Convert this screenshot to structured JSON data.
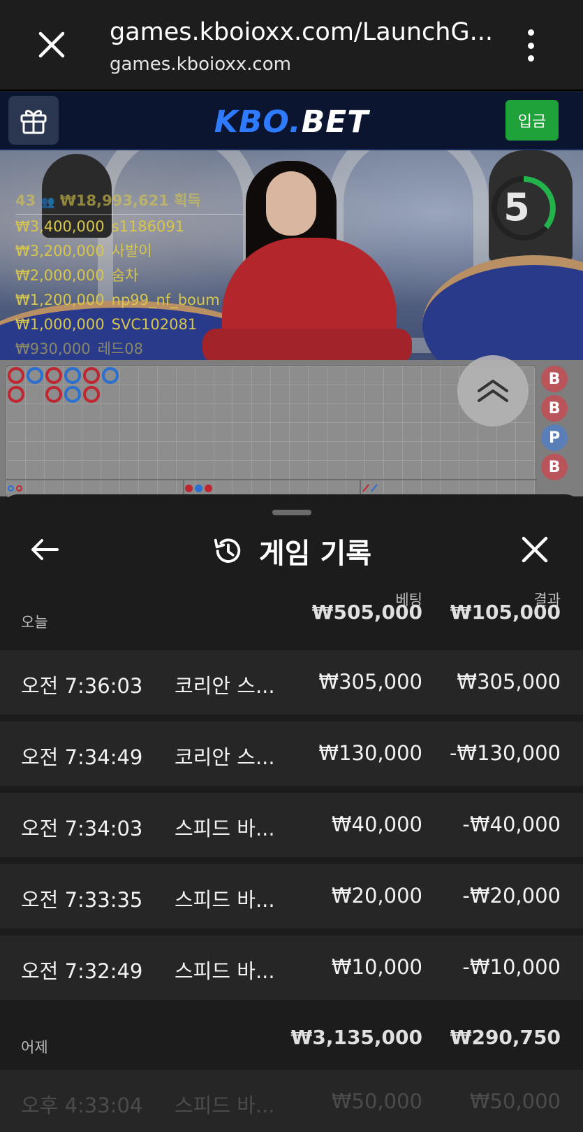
{
  "browser": {
    "url": "games.kboioxx.com/LaunchG...",
    "domain": "games.kboioxx.com"
  },
  "site": {
    "logo_part1": "KBO.",
    "logo_part2": "BET",
    "deposit_label": "입금"
  },
  "video": {
    "total_winners": "43",
    "total_amount": "₩18,993,621",
    "total_suffix": "획득",
    "winners": [
      {
        "amount": "₩3,400,000",
        "name": "s1186091"
      },
      {
        "amount": "₩3,200,000",
        "name": "사발이"
      },
      {
        "amount": "₩2,000,000",
        "name": "숨차"
      },
      {
        "amount": "₩1,200,000",
        "name": "np99_nf_boum"
      },
      {
        "amount": "₩1,000,000",
        "name": "SVC102081"
      },
      {
        "amount": "₩930,000",
        "name": "레드08"
      }
    ],
    "countdown": "5"
  },
  "roadmap": {
    "side_beads": [
      "B",
      "B",
      "P",
      "B"
    ]
  },
  "sheet": {
    "title": "게임 기록",
    "col_bet": "베팅",
    "col_result": "결과",
    "today": {
      "label": "오늘",
      "bet_total": "₩505,000",
      "result_total": "₩105,000"
    },
    "rows": [
      {
        "time": "오전 7:36:03",
        "game": "코리안 스...",
        "bet": "₩305,000",
        "result": "₩305,000"
      },
      {
        "time": "오전 7:34:49",
        "game": "코리안 스...",
        "bet": "₩130,000",
        "result": "-₩130,000"
      },
      {
        "time": "오전 7:34:03",
        "game": "스피드 바...",
        "bet": "₩40,000",
        "result": "-₩40,000"
      },
      {
        "time": "오전 7:33:35",
        "game": "스피드 바...",
        "bet": "₩20,000",
        "result": "-₩20,000"
      },
      {
        "time": "오전 7:32:49",
        "game": "스피드 바...",
        "bet": "₩10,000",
        "result": "-₩10,000"
      }
    ],
    "yesterday": {
      "label": "어제",
      "bet_total": "₩3,135,000",
      "result_total": "₩290,750"
    },
    "faded_row": {
      "time": "오후 4:33:04",
      "game": "스피드 바...",
      "bet": "₩50,000",
      "result": "₩50,000"
    }
  },
  "colors": {
    "banker_red": "#c0262f",
    "player_blue": "#2a6fd2",
    "deposit_green": "#1fa23a",
    "logo_blue": "#2e7bff"
  }
}
